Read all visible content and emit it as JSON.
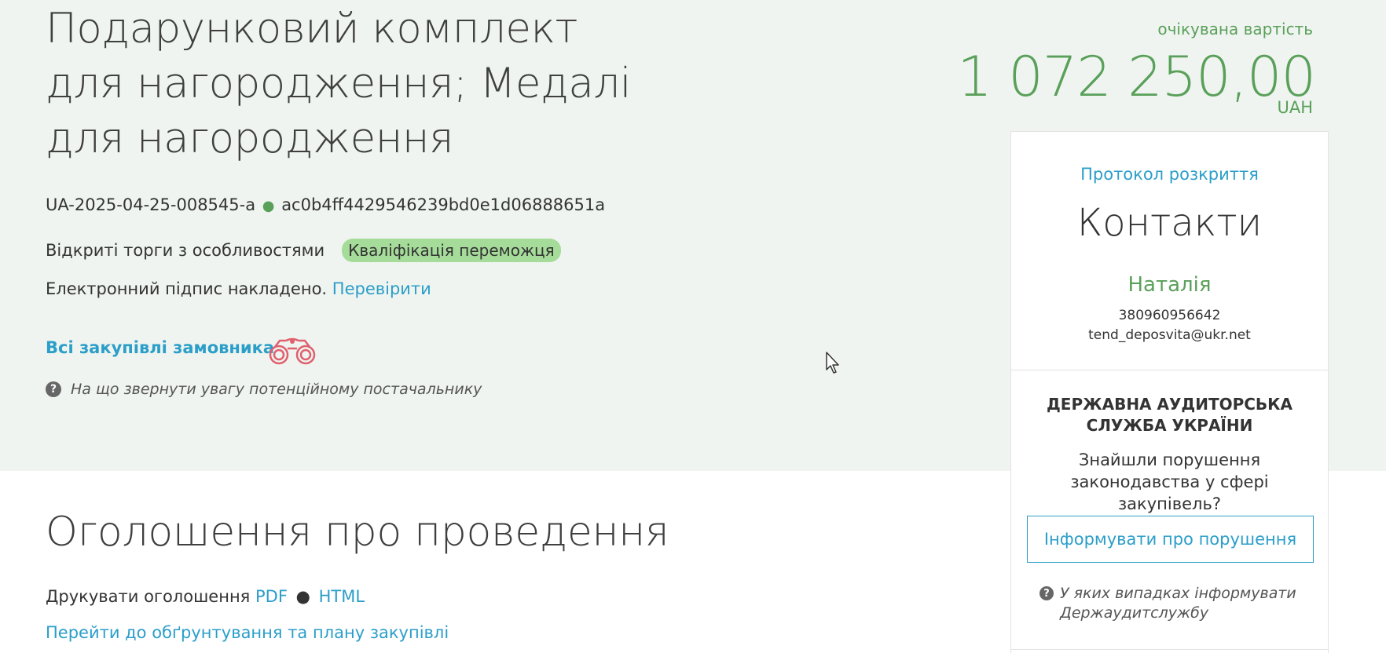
{
  "tender": {
    "title": "Подарунковий комплект для нагородження; Медалі для нагородження",
    "id": "UA-2025-04-25-008545-a",
    "separator": "●",
    "hash": "ac0b4ff4429546239bd0e1d06888651a",
    "procedure_type": "Відкриті торги з особливостями",
    "status": "Кваліфікація переможця",
    "signature_text": "Електронний підпис накладено.",
    "verify_link": "Перевірити",
    "all_purchases_link": "Всі закупівлі замовника",
    "hint_text": "На що звернути увагу потенційному постачальнику"
  },
  "value": {
    "label": "очікувана вартість",
    "amount": "1 072 250,00",
    "currency": "UAH"
  },
  "announcement": {
    "title": "Оголошення про проведення",
    "print_label": "Друкувати оголошення",
    "pdf_link": "PDF",
    "separator": "●",
    "html_link": "HTML",
    "plan_link": "Перейти до обґрунтування та плану закупівлі"
  },
  "sidebar": {
    "protocol_link": "Протокол розкриття",
    "contacts_title": "Контакти",
    "contact_name": "Наталія",
    "contact_phone": "380960956642",
    "contact_email": "tend_deposvita@ukr.net",
    "audit_title": "ДЕРЖАВНА АУДИТОРСЬКА СЛУЖБА УКРАЇНИ",
    "audit_text": "Знайшли порушення законодавства у сфері закупівель?",
    "report_button": "Інформувати про порушення",
    "audit_hint": "У яких випадках інформувати Держаудитслужбу"
  },
  "icons": {
    "question": "?",
    "binoculars": "binoculars-icon",
    "cursor": "mouse-cursor-icon"
  },
  "colors": {
    "accent_green": "#5aa05a",
    "link_blue": "#2b9ec9",
    "hero_bg": "#eff4f0",
    "badge_bg": "#a6dc9a",
    "binoculars": "#e0606e"
  }
}
